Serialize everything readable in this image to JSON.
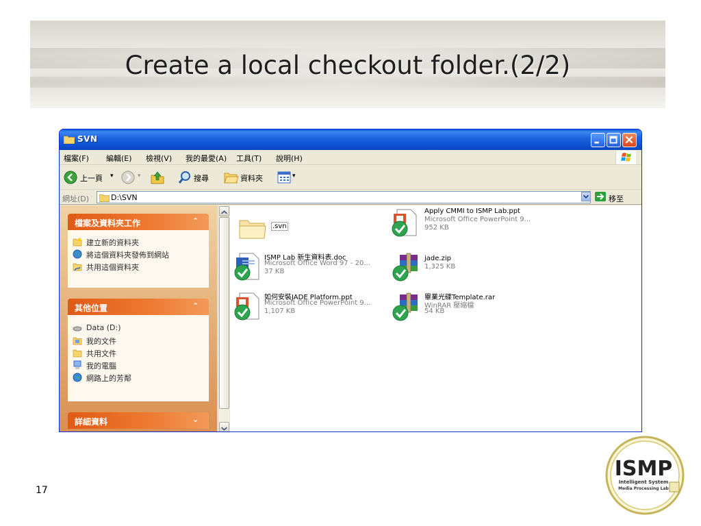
{
  "slide": {
    "title": "Create a local checkout folder.(2/2)",
    "page_number": "17"
  },
  "window": {
    "title": "SVN",
    "menu": [
      "檔案(F)",
      "編輯(E)",
      "檢視(V)",
      "我的最愛(A)",
      "工具(T)",
      "說明(H)"
    ],
    "toolbar": {
      "back_label": "上一頁",
      "search_label": "搜尋",
      "folders_label": "資料夾"
    },
    "address": {
      "label": "網址(D)",
      "path": "D:\\SVN",
      "go_label": "移至"
    }
  },
  "sidebar": {
    "file_tasks": {
      "title": "檔案及資料夾工作",
      "items": [
        "建立新的資料夾",
        "將這個資料夾發佈到網站",
        "共用這個資料夾"
      ]
    },
    "other_places": {
      "title": "其他位置",
      "items": [
        "Data (D:)",
        "我的文件",
        "共用文件",
        "我的電腦",
        "網路上的芳鄰"
      ]
    },
    "details": {
      "title": "詳細資料"
    }
  },
  "files": [
    {
      "name": ".svn",
      "type": "",
      "size": "",
      "icon": "folder-icon"
    },
    {
      "name": "Apply CMMI to ISMP Lab.ppt",
      "type": "Microsoft Office PowerPoint 9...",
      "size": "952 KB",
      "icon": "ppt-icon"
    },
    {
      "name": "ISMP Lab 新生資料表.doc",
      "type": "Microsoft Office Word 97 - 20...",
      "size": "37 KB",
      "icon": "doc-icon"
    },
    {
      "name": "jade.zip",
      "type": "",
      "size": "1,325 KB",
      "icon": "zip-icon"
    },
    {
      "name": "如何安裝JADE Platform.ppt",
      "type": "Microsoft Office PowerPoint 9...",
      "size": "1,107 KB",
      "icon": "ppt-icon"
    },
    {
      "name": "畢業光碟Template.rar",
      "type": "WinRAR 壓縮檔",
      "size": "54 KB",
      "icon": "rar-icon"
    }
  ],
  "logo": {
    "text_main": "ISMP",
    "line1": "Intelligent System",
    "line2": "Media Processing Lab"
  },
  "colors": {
    "xp_title_blue": "#0a5bd8",
    "panel_orange": "#e05a16",
    "svn_check_green": "#2ea44f"
  }
}
